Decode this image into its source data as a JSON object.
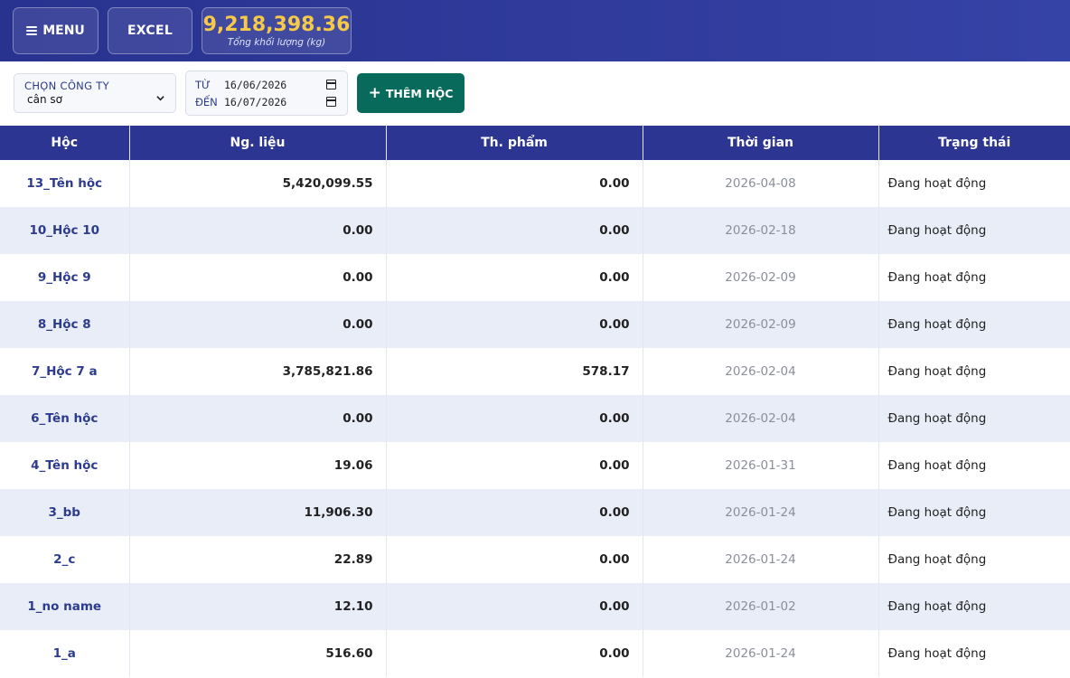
{
  "header": {
    "menu_label": "MENU",
    "excel_label": "EXCEL",
    "total_value": "9,218,398.36",
    "total_caption": "Tổng khối lượng (kg)"
  },
  "filters": {
    "company_label": "CHỌN CÔNG TY",
    "company_value": "cân sơ",
    "from_label": "TỪ",
    "from_date": "16/06/2026",
    "to_label": "ĐẾN",
    "to_date": "16/07/2026",
    "add_label": "THÊM HỘC"
  },
  "table": {
    "columns": [
      "Hộc",
      "Ng. liệu",
      "Th. phẩm",
      "Thời gian",
      "Trạng thái"
    ],
    "rows": [
      {
        "name": "13_Tên hộc",
        "material": "5,420,099.55",
        "product": "0.00",
        "time": "2026-04-08",
        "status": "Đang hoạt động"
      },
      {
        "name": "10_Hộc 10",
        "material": "0.00",
        "product": "0.00",
        "time": "2026-02-18",
        "status": "Đang hoạt động"
      },
      {
        "name": "9_Hộc 9",
        "material": "0.00",
        "product": "0.00",
        "time": "2026-02-09",
        "status": "Đang hoạt động"
      },
      {
        "name": "8_Hộc 8",
        "material": "0.00",
        "product": "0.00",
        "time": "2026-02-09",
        "status": "Đang hoạt động"
      },
      {
        "name": "7_Hộc 7 a",
        "material": "3,785,821.86",
        "product": "578.17",
        "time": "2026-02-04",
        "status": "Đang hoạt động"
      },
      {
        "name": "6_Tên hộc",
        "material": "0.00",
        "product": "0.00",
        "time": "2026-02-04",
        "status": "Đang hoạt động"
      },
      {
        "name": "4_Tên hộc",
        "material": "19.06",
        "product": "0.00",
        "time": "2026-01-31",
        "status": "Đang hoạt động"
      },
      {
        "name": "3_bb",
        "material": "11,906.30",
        "product": "0.00",
        "time": "2026-01-24",
        "status": "Đang hoạt động"
      },
      {
        "name": "2_c",
        "material": "22.89",
        "product": "0.00",
        "time": "2026-01-24",
        "status": "Đang hoạt động"
      },
      {
        "name": "1_no name",
        "material": "12.10",
        "product": "0.00",
        "time": "2026-01-02",
        "status": "Đang hoạt động"
      },
      {
        "name": "1_a",
        "material": "516.60",
        "product": "0.00",
        "time": "2026-01-24",
        "status": "Đang hoạt động"
      }
    ]
  },
  "colors": {
    "header_bg": "#2c3592",
    "accent_total": "#f7c948",
    "add_button": "#086a5a",
    "row_stripe": "#e9edf7",
    "name_text": "#2d3b8f"
  },
  "icons": {
    "menu": "hamburger-icon",
    "dropdown": "chevron-down-icon",
    "date": "calendar-icon",
    "add": "plus-icon"
  }
}
